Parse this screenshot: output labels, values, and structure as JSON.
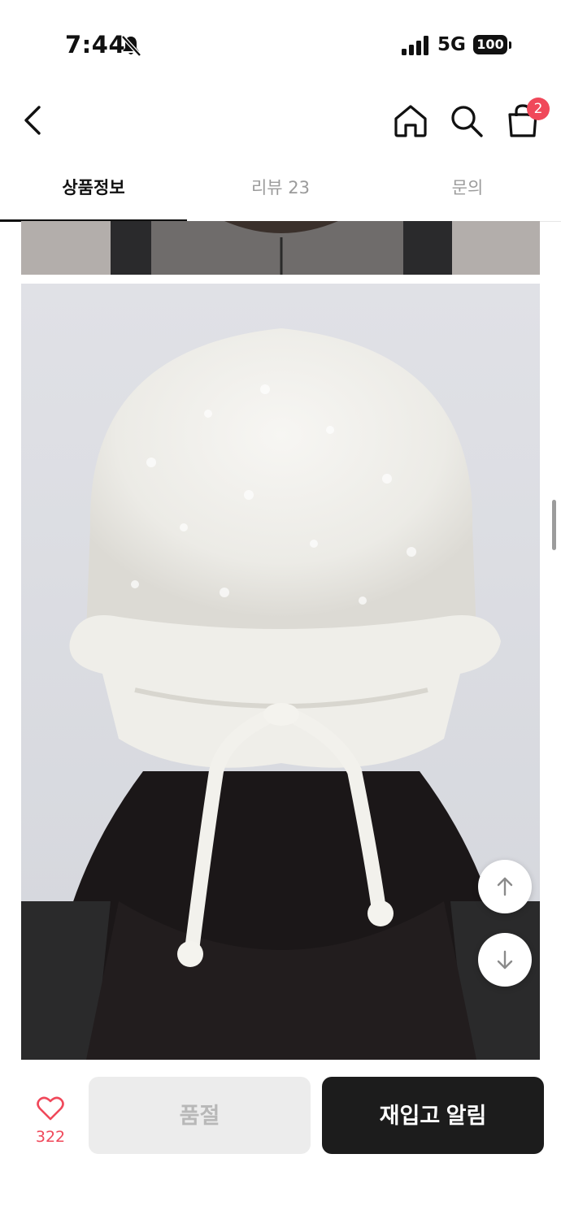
{
  "status_bar": {
    "time": "7:44",
    "network": "5G",
    "battery": "100",
    "icons": [
      "bell-slash-icon",
      "signal-icon",
      "battery-icon"
    ]
  },
  "header": {
    "icons": [
      "chevron-left-icon",
      "home-icon",
      "search-icon",
      "shopping-bag-icon"
    ],
    "cart_badge": "2"
  },
  "tabs": [
    {
      "label": "상품정보",
      "active": true
    },
    {
      "label": "리뷰 23",
      "active": false
    },
    {
      "label": "문의",
      "active": false
    }
  ],
  "scroll_buttons": {
    "icons": [
      "arrow-up-icon",
      "arrow-down-icon"
    ]
  },
  "bottom_bar": {
    "like_count": "322",
    "soldout_label": "품절",
    "restock_label": "재입고 알림",
    "icons": [
      "heart-icon"
    ],
    "colors": {
      "accent": "#f0485a",
      "primary": "#1c1c1c",
      "disabled": "#ececec"
    }
  }
}
